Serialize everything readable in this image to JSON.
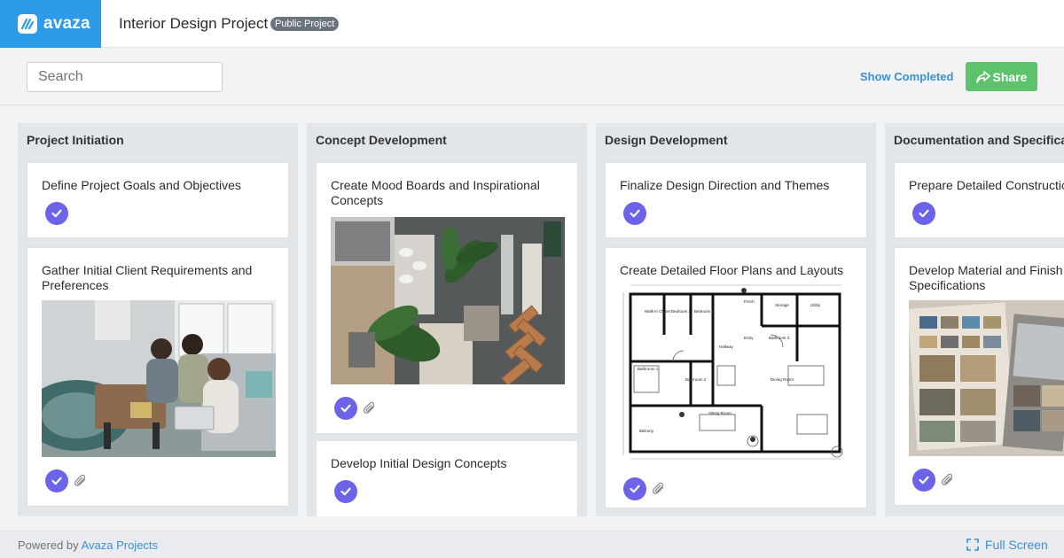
{
  "header": {
    "logo_text": "avaza",
    "project_title": "Interior Design Project",
    "badge": "Public Project"
  },
  "toolbar": {
    "search_placeholder": "Search",
    "show_completed": "Show Completed",
    "share": "Share"
  },
  "columns": [
    {
      "title": "Project Initiation",
      "cards": [
        {
          "title": "Define Project Goals and Objectives",
          "completed": true,
          "attachment": false
        },
        {
          "title": "Gather Initial Client Requirements and Preferences",
          "completed": true,
          "attachment": true,
          "image": "clients-meeting-photo"
        }
      ]
    },
    {
      "title": "Concept Development",
      "cards": [
        {
          "title": "Create Mood Boards and Inspirational Concepts",
          "completed": true,
          "attachment": true,
          "image": "mood-board-photo"
        },
        {
          "title": "Develop Initial Design Concepts",
          "completed": true,
          "attachment": false
        }
      ]
    },
    {
      "title": "Design Development",
      "cards": [
        {
          "title": "Finalize Design Direction and Themes",
          "completed": true,
          "attachment": false
        },
        {
          "title": "Create Detailed Floor Plans and Layouts",
          "completed": true,
          "attachment": true,
          "image": "floor-plan-drawing"
        }
      ]
    },
    {
      "title": "Documentation and Specifications",
      "cards": [
        {
          "title": "Prepare Detailed Construction Documents",
          "completed": true,
          "attachment": false
        },
        {
          "title": "Develop Material and Finish Specifications",
          "completed": true,
          "attachment": true,
          "image": "material-samples-photo"
        }
      ]
    }
  ],
  "floor_plan_labels": [
    "Walk-in Closet",
    "Bedroom 3",
    "Bedroom 4",
    "Porch",
    "Storage",
    "Utility",
    "Hallway",
    "Entry",
    "Bathroom 3",
    "Bathroom 1",
    "Bathroom 2",
    "Dining Room",
    "Sitting Room",
    "Balcony"
  ],
  "footer": {
    "powered_prefix": "Powered by",
    "powered_link": "Avaza Projects",
    "fullscreen": "Full Screen"
  },
  "colors": {
    "brand": "#2e9be8",
    "check": "#6d63e8",
    "share": "#5cc36c",
    "link": "#3d8fd6"
  }
}
